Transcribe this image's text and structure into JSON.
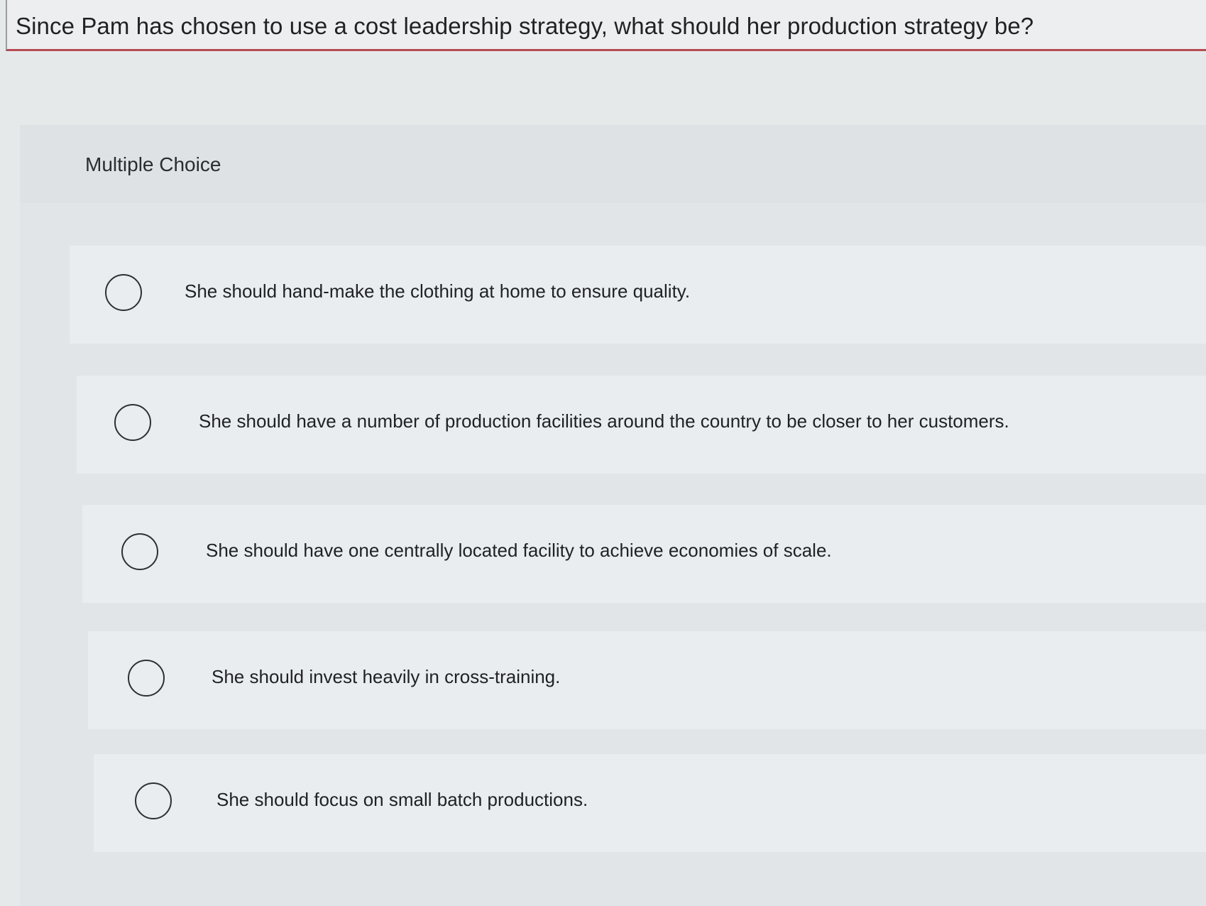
{
  "question": {
    "text": "Since Pam has chosen to use a cost leadership strategy, what should her production strategy be?"
  },
  "section": {
    "label": "Multiple Choice"
  },
  "options": [
    {
      "label": "She should hand-make the clothing at home to ensure quality."
    },
    {
      "label": "She should have a number of production facilities around the country to be closer to her customers."
    },
    {
      "label": "She should have one centrally located facility to achieve economies of scale."
    },
    {
      "label": "She should invest heavily in cross-training."
    },
    {
      "label": "She should focus on small batch productions."
    }
  ]
}
